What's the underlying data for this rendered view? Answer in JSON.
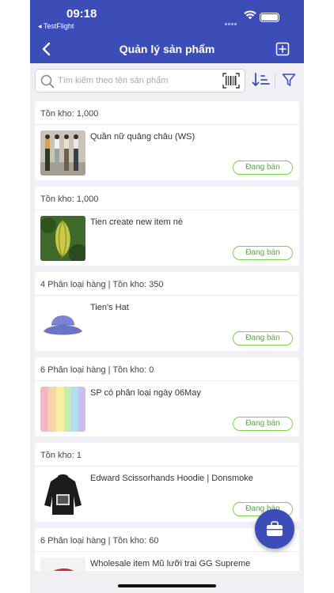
{
  "status_bar": {
    "time": "09:18",
    "back_app": "◂ TestFlight"
  },
  "navbar": {
    "title": "Quản lý sản phẩm",
    "back_icon": "chevron-left-icon",
    "add_icon": "add-square-icon"
  },
  "search": {
    "placeholder": "Tìm kiếm theo tên sản phẩm",
    "value": ""
  },
  "products": [
    {
      "header": "Tồn kho: 1,000",
      "name": "Quần nữ quảng châu (WS)",
      "status": "Đang bán",
      "thumb": "pants-photo"
    },
    {
      "header": "Tồn kho: 1,000",
      "name": "Tien create new item nè",
      "status": "Đang bán",
      "thumb": "starfruit-photo"
    },
    {
      "header": "4 Phân loại hàng | Tồn kho: 350",
      "name": "Tien's Hat",
      "status": "Đang bán",
      "thumb": "bucket-hat-photo"
    },
    {
      "header": "6 Phân loại hàng | Tồn kho: 0",
      "name": "SP có phân loại ngày 06May",
      "status": "Đang bán",
      "thumb": "rainbow-stripes"
    },
    {
      "header": "Tồn kho: 1",
      "name": "Edward Scissorhands Hoodie | Donsmoke",
      "status": "Đang bán",
      "thumb": "hoodie-photo"
    },
    {
      "header": "6 Phân loại hàng | Tồn kho: 60",
      "name": "Wholesale item Mũ lưỡi trai GG Supreme",
      "status": "",
      "thumb": "cap-photo"
    }
  ],
  "colors": {
    "primary": "#3c4db7",
    "status_green": "#4caf2a",
    "background": "#efeff4"
  },
  "fab_icon": "briefcase-icon"
}
